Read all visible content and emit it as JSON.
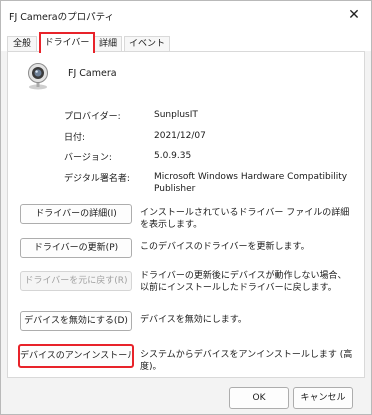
{
  "window": {
    "title": "FJ Cameraのプロパティ",
    "close_glyph": "✕"
  },
  "tabs": [
    {
      "label": "全般",
      "active": false
    },
    {
      "label": "ドライバー",
      "active": true
    },
    {
      "label": "詳細",
      "active": false
    },
    {
      "label": "イベント",
      "active": false
    }
  ],
  "device": {
    "name": "FJ Camera",
    "icon": "webcam-icon"
  },
  "properties": {
    "provider": {
      "label": "プロバイダー:",
      "value": "SunplusIT"
    },
    "date": {
      "label": "日付:",
      "value": "2021/12/07"
    },
    "version": {
      "label": "バージョン:",
      "value": "5.0.9.35"
    },
    "signer": {
      "label": "デジタル署名者:",
      "value_line1": "Microsoft Windows Hardware Compatibility",
      "value_line2": "Publisher"
    }
  },
  "actions": {
    "details": {
      "label": "ドライバーの詳細(I)",
      "desc": "インストールされているドライバー ファイルの詳細を表示します。"
    },
    "update": {
      "label": "ドライバーの更新(P)",
      "desc": "このデバイスのドライバーを更新します。"
    },
    "rollback": {
      "label": "ドライバーを元に戻す(R)",
      "desc": "ドライバーの更新後にデバイスが動作しない場合、以前にインストールしたドライバーに戻します。",
      "enabled": false
    },
    "disable": {
      "label": "デバイスを無効にする(D)",
      "desc": "デバイスを無効にします。"
    },
    "uninstall": {
      "label": "デバイスのアンインストール(U)",
      "desc": "システムからデバイスをアンインストールします (高度)。"
    }
  },
  "footer": {
    "ok": "OK",
    "cancel": "キャンセル"
  },
  "colors": {
    "highlight": "#e8232a"
  }
}
